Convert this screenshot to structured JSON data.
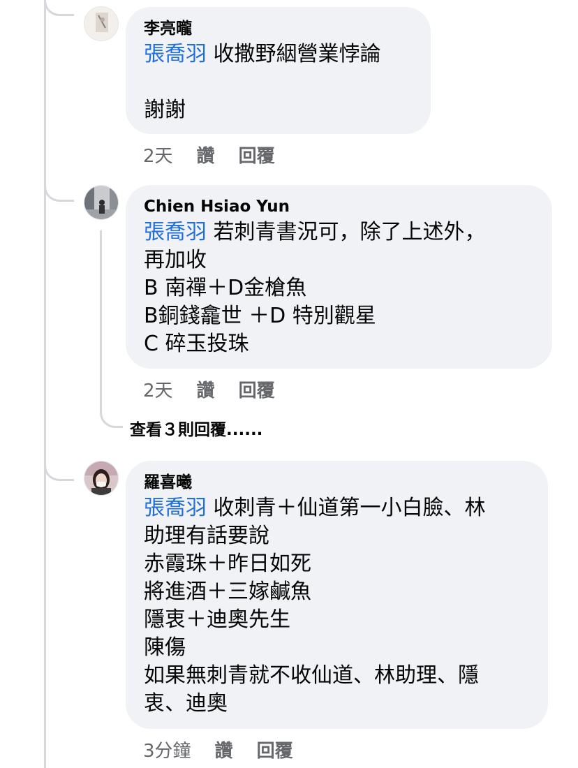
{
  "comments": [
    {
      "author": "李亮曨",
      "mention": "張喬羽",
      "text": " 收撒野絪營業悖論\n\n謝謝",
      "time": "2天",
      "like_label": "讚",
      "reply_label": "回覆"
    },
    {
      "author": "Chien Hsiao Yun",
      "mention": "張喬羽",
      "text": " 若刺青書況可，除了上述外，\n再加收\nB 南禪＋D金槍魚\nB銅錢龕世 ＋D 特別觀星\nC 碎玉投珠",
      "time": "2天",
      "like_label": "讚",
      "reply_label": "回覆",
      "more_replies": "查看３則回覆......"
    },
    {
      "author": "羅喜曦",
      "mention": "張喬羽",
      "text": " 收刺青＋仙道第一小白臉、林\n助理有話要說\n赤霞珠＋昨日如死\n將進酒＋三嫁鹹魚\n隱衷＋迪奧先生\n陳傷\n如果無刺青就不收仙道、林助理、隱\n衷、迪奧",
      "time": "3分鐘",
      "like_label": "讚",
      "reply_label": "回覆"
    }
  ],
  "colors": {
    "bubble": "#f0f2f5",
    "mention": "#216fdb",
    "meta": "#65676b",
    "thread_line": "#d5d7db"
  }
}
